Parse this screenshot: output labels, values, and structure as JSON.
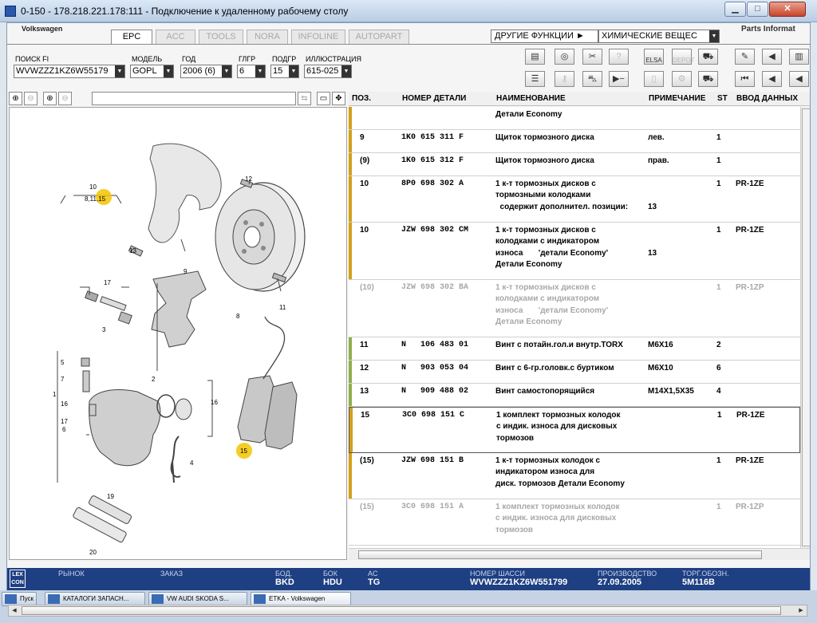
{
  "window": {
    "title": "0-150 - 178.218.221.178:111 - Подключение к удаленному рабочему столу"
  },
  "brand": "Volkswagen",
  "tabs": [
    {
      "label": "EPC"
    },
    {
      "label": "ACC"
    },
    {
      "label": "TOOLS"
    },
    {
      "label": "NORA"
    },
    {
      "label": "INFOLINE"
    },
    {
      "label": "AUTOPART"
    }
  ],
  "menus": {
    "other_functions": "ДРУГИЕ ФУНКЦИИ ►",
    "chemicals": "ХИМИЧЕСКИЕ ВЕЩЕС",
    "parts_info": "Parts Informat"
  },
  "filters": {
    "search_label": "ПОИСК FI",
    "search_value": "WVWZZZ1KZ6W55179",
    "model_label": "МОДЕЛЬ",
    "model_value": "GOPL",
    "year_label": "ГОД",
    "year_value": "2006 (6)",
    "group_label": "ГЛГР",
    "group_value": "6",
    "subgroup_label": "ПОДГР",
    "subgroup_value": "15",
    "illustration_label": "ИЛЛЮСТРАЦИЯ",
    "illustration_value": "615-025"
  },
  "toolbar": {
    "elsa": "ELSA",
    "depot": "DEPOT"
  },
  "illustration": {
    "callouts": [
      "10",
      "8,11,15",
      "12",
      "13",
      "9",
      "17",
      "3",
      "2",
      "8",
      "11",
      "5",
      "1",
      "16",
      "4",
      "15",
      "19",
      "20",
      "7",
      "6",
      "17",
      "16"
    ]
  },
  "grid": {
    "headers": {
      "pos": "ПОЗ.",
      "part": "НОМЕР ДЕТАЛИ",
      "name": "НАИМЕНОВАНИЕ",
      "note": "ПРИМЕЧАНИЕ",
      "st": "ST",
      "input": "ВВОД ДАННЫХ"
    },
    "rows": [
      {
        "pos": "",
        "part": "",
        "name": "Детали Economy",
        "note": "",
        "st": "",
        "data": "",
        "bar": "#d4a017",
        "grey": false
      },
      {
        "pos": "9",
        "part": "1K0 615 311 F",
        "name": "Щиток тормозного диска",
        "note": "лев.",
        "st": "1",
        "data": "",
        "bar": "#d4a017",
        "grey": false
      },
      {
        "pos": "(9)",
        "part": "1K0 615 312 F",
        "name": "Щиток тормозного диска",
        "note": "прав.",
        "st": "1",
        "data": "",
        "bar": "#d4a017",
        "grey": false
      },
      {
        "pos": "10",
        "part": "8P0 698 302 A",
        "name": "1 к-т тормозных дисков с\nтормозными колодками\n  содержит дополнител. позиции:",
        "note": "\n\n13",
        "st": "1",
        "data": "PR-1ZE",
        "bar": "#d4a017",
        "grey": false
      },
      {
        "pos": "10",
        "part": "JZW 698 302 CM",
        "name": "1 к-т тормозных дисков с\nколодками с индикатором\nизноса       'детали Economy'\nДетали Economy",
        "note": "\n\n13",
        "st": "1",
        "data": "PR-1ZE",
        "bar": "#d4a017",
        "grey": false
      },
      {
        "pos": "(10)",
        "part": "JZW 698 302 BA",
        "name": "1 к-т тормозных дисков с\nколодками с индикатором\nизноса       'детали Economy'\nДетали Economy",
        "note": "",
        "st": "1",
        "data": "PR-1ZP",
        "bar": "",
        "grey": true
      },
      {
        "pos": "11",
        "part": "N   106 483 01",
        "name": "Винт с потайн.гол.и внутр.TORX",
        "note": "M6X16",
        "st": "2",
        "data": "",
        "bar": "#8faf4a",
        "grey": false
      },
      {
        "pos": "12",
        "part": "N   903 053 04",
        "name": "Винт с 6-гр.головк.с буртиком",
        "note": "M6X10",
        "st": "6",
        "data": "",
        "bar": "#8faf4a",
        "grey": false
      },
      {
        "pos": "13",
        "part": "N   909 488 02",
        "name": "Винт самостопорящийся",
        "note": "M14X1,5X35",
        "st": "4",
        "data": "",
        "bar": "#8faf4a",
        "grey": false
      },
      {
        "pos": "15",
        "part": "3C0 698 151 C",
        "name": "1 комплект тормозных колодок\nс индик. износа для дисковых\nтормозов",
        "note": "",
        "st": "1",
        "data": "PR-1ZE",
        "bar": "#d4a017",
        "grey": false
      },
      {
        "pos": "(15)",
        "part": "JZW 698 151 B",
        "name": "1 к-т тормозных колодок с\nиндикатором износа для\nдиск. тормозов Детали Economy",
        "note": "",
        "st": "1",
        "data": "PR-1ZE",
        "bar": "#d4a017",
        "grey": false
      },
      {
        "pos": "(15)",
        "part": "3C0 698 151 A",
        "name": "1 комплект тормозных колодок\nс индик. износа для дисковых\nтормозов",
        "note": "",
        "st": "1",
        "data": "PR-1ZP",
        "bar": "",
        "grey": true
      }
    ]
  },
  "status": {
    "market_label": "РЫНОК",
    "order_label": "ЗАКАЗ",
    "bod_label": "БОД.",
    "bod_value": "BKD",
    "block_label": "БОК",
    "block_value": "HDU",
    "ac_label": "AC",
    "ac_value": "TG",
    "chassis_label": "НОМЕР ШАССИ",
    "chassis_value": "WVWZZZ1KZ6W551799",
    "prod_label": "ПРОИЗВОДСТВО",
    "prod_value": "27.09.2005",
    "trade_label": "ТОРГ.ОБОЗН.",
    "trade_value": "5M116B",
    "logo": "LEX CON"
  },
  "taskbar": {
    "items": [
      {
        "label": "Пуск"
      },
      {
        "label": "КАТАЛОГИ ЗАПАСН..."
      },
      {
        "label": "VW AUDI SKODA S..."
      },
      {
        "label": "ETKA - Volkswagen"
      }
    ]
  }
}
